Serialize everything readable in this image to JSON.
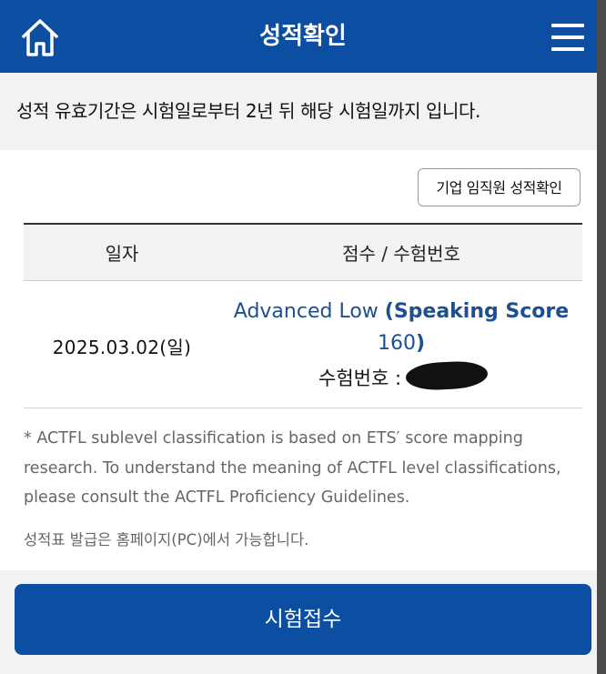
{
  "header": {
    "title": "성적확인",
    "home_icon": "home-icon",
    "menu_icon": "hamburger-menu-icon",
    "background": "#0b4ea2"
  },
  "notice": {
    "text": "성적 유효기간은 시험일로부터 2년 뒤 해당 시험일까지 입니다."
  },
  "corp_button": {
    "label": "기업 임직원 성적확인"
  },
  "table": {
    "headers": [
      "일자",
      "점수 / 수험번호"
    ],
    "rows": [
      {
        "date": "2025.03.02(일)",
        "level": "Advanced Low ",
        "score_prefix": "(Speaking Score",
        "score_value": "160",
        "score_suffix": ")",
        "exam_no_label": "수험번호 :"
      }
    ]
  },
  "footnote": {
    "lines": [
      "* ACTFL sublevel classification is based on ETS′ score mapping",
      "research. To understand the meaning of ACTFL level classifications,",
      "please consult the ACTFL Proficiency Guidelines."
    ]
  },
  "print_note": "성적표 발급은 홈페이지(PC)에서 가능합니다.",
  "register_button": {
    "label": "시험접수"
  },
  "colors": {
    "primary": "#0b4ea2",
    "score_text": "#1e4f8e"
  }
}
